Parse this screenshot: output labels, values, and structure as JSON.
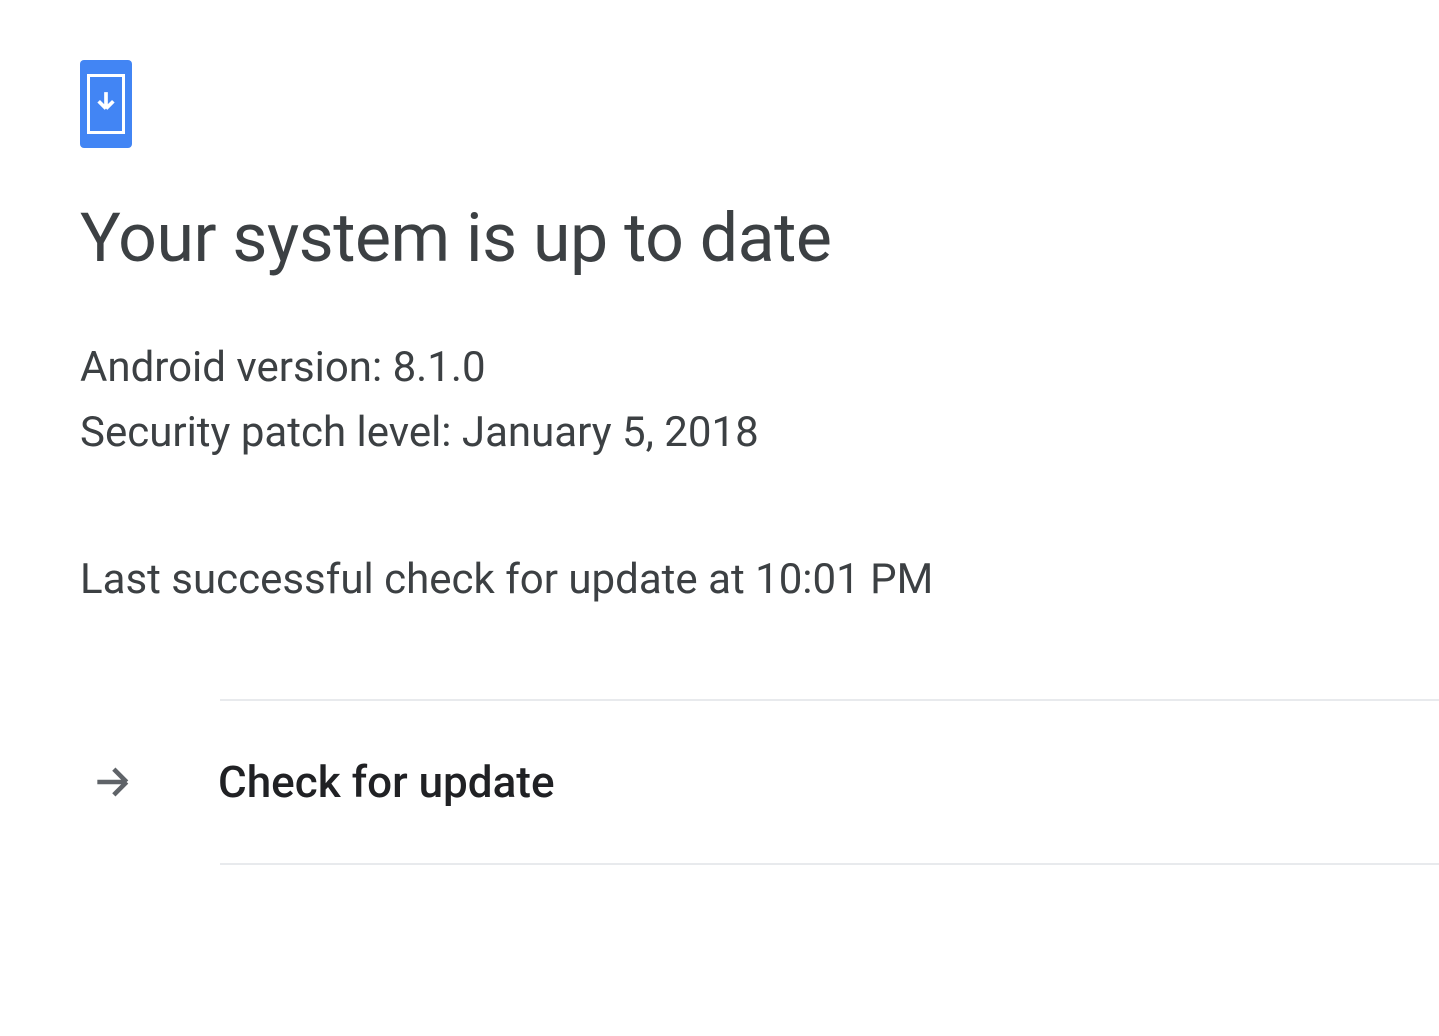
{
  "header": {
    "icon": "system-update-icon"
  },
  "title": "Your system is up to date",
  "info": {
    "android_version_label": "Android version: 8.1.0",
    "security_patch_label": "Security patch level: January 5, 2018"
  },
  "last_check": "Last successful check for update at 10:01 PM",
  "action": {
    "check_update_label": "Check for update"
  }
}
